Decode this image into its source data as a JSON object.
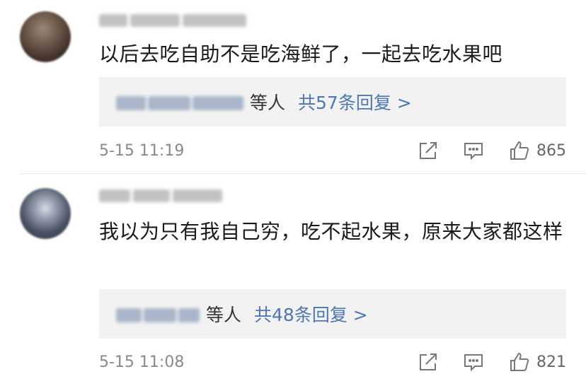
{
  "comments": [
    {
      "text": "以后去吃自助不是吃海鲜了，一起去吃水果吧",
      "reply_suffix": "等人",
      "reply_count": "共57条回复 >",
      "time": "5-15 11:19",
      "likes": "865"
    },
    {
      "text": "我以为只有我自己穷，吃不起水果，原来大家都这样",
      "reply_suffix": "等人",
      "reply_count": "共48条回复 >",
      "time": "5-15 11:08",
      "likes": "821"
    }
  ],
  "icons": {
    "share": "share-icon",
    "comment": "comment-icon",
    "like": "thumbs-up-icon"
  },
  "colors": {
    "link": "#4f76b5",
    "reply_bg": "#f2f2f2",
    "meta_text": "#8a8a8a"
  }
}
